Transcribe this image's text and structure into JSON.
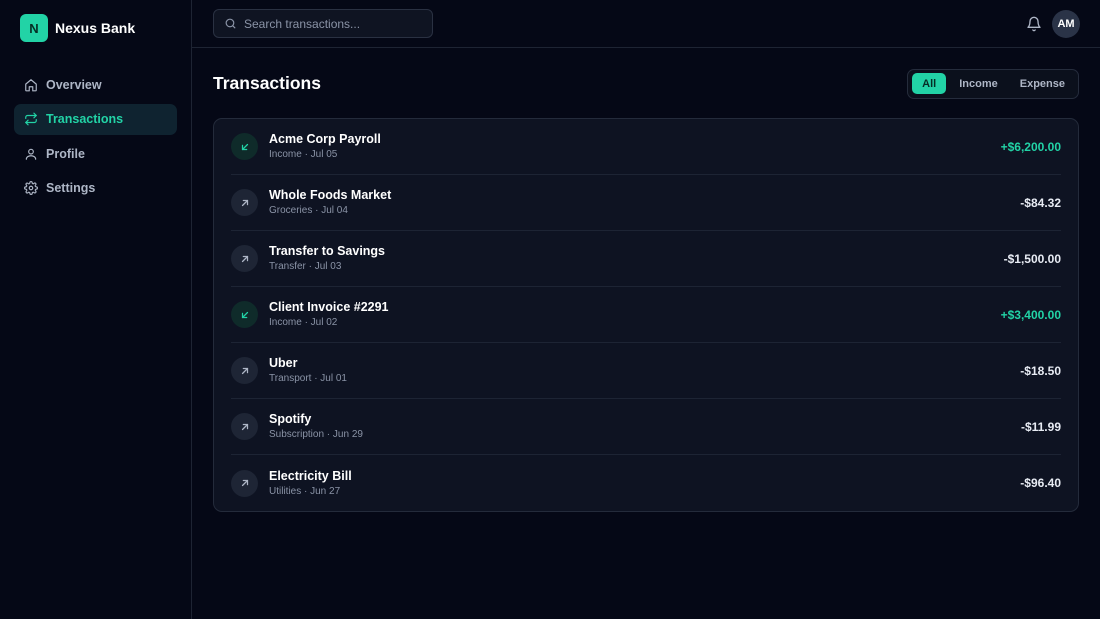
{
  "brand": {
    "logo_letter": "N",
    "name": "Nexus Bank"
  },
  "sidebar": {
    "items": [
      {
        "label": "Overview",
        "icon": "home-icon"
      },
      {
        "label": "Transactions",
        "icon": "transfer-arrows-icon",
        "active": true
      },
      {
        "label": "Profile",
        "icon": "user-icon"
      },
      {
        "label": "Settings",
        "icon": "gear-icon"
      }
    ]
  },
  "topbar": {
    "search_placeholder": "Search transactions...",
    "avatar_initials": "AM"
  },
  "page": {
    "title": "Transactions",
    "filters": [
      {
        "label": "All",
        "active": true
      },
      {
        "label": "Income",
        "active": false
      },
      {
        "label": "Expense",
        "active": false
      }
    ]
  },
  "transactions": [
    {
      "name": "Acme Corp Payroll",
      "meta": "Income · Jul 05",
      "amount": "+$6,200.00",
      "direction": "in"
    },
    {
      "name": "Whole Foods Market",
      "meta": "Groceries · Jul 04",
      "amount": "-$84.32",
      "direction": "out"
    },
    {
      "name": "Transfer to Savings",
      "meta": "Transfer · Jul 03",
      "amount": "-$1,500.00",
      "direction": "out"
    },
    {
      "name": "Client Invoice #2291",
      "meta": "Income · Jul 02",
      "amount": "+$3,400.00",
      "direction": "in"
    },
    {
      "name": "Uber",
      "meta": "Transport · Jul 01",
      "amount": "-$18.50",
      "direction": "out"
    },
    {
      "name": "Spotify",
      "meta": "Subscription · Jun 29",
      "amount": "-$11.99",
      "direction": "out"
    },
    {
      "name": "Electricity Bill",
      "meta": "Utilities · Jun 27",
      "amount": "-$96.40",
      "direction": "out"
    }
  ],
  "colors": {
    "accent": "#22d3a6",
    "background": "#050816",
    "card": "#0e1322"
  }
}
